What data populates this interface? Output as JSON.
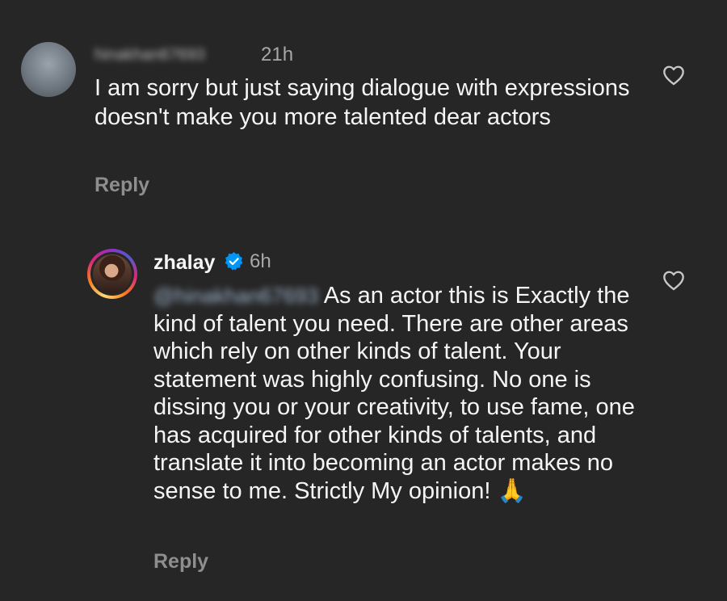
{
  "comments": [
    {
      "username": "hinakhan67693",
      "time": "21h",
      "text": "I am sorry but just saying dialogue with expressions doesn't make you more talented dear actors",
      "reply_label": "Reply",
      "icons": {
        "avatar": "avatar",
        "like": "heart-outline-icon"
      }
    },
    {
      "username": "zhalay",
      "verified": true,
      "time": "6h",
      "mention": "@hinakhan67693",
      "text": "As an actor this is Exactly the kind of talent you need. There are other areas which rely on other kinds of talent. Your statement was highly confusing. No one is dissing you or your creativity, to use fame, one has acquired for other kinds of talents, and translate it into becoming an actor makes no sense to me. Strictly My opinion!",
      "emoji": "🙏",
      "reply_label": "Reply",
      "icons": {
        "avatar": "avatar-with-story-ring",
        "verified": "verified-badge-icon",
        "like": "heart-outline-icon"
      }
    }
  ],
  "colors": {
    "background": "#262626",
    "primary_text": "#f5f5f5",
    "secondary_text": "#a8a8a8",
    "reply_text": "#8e8e8e",
    "verified_blue": "#0095f6"
  }
}
